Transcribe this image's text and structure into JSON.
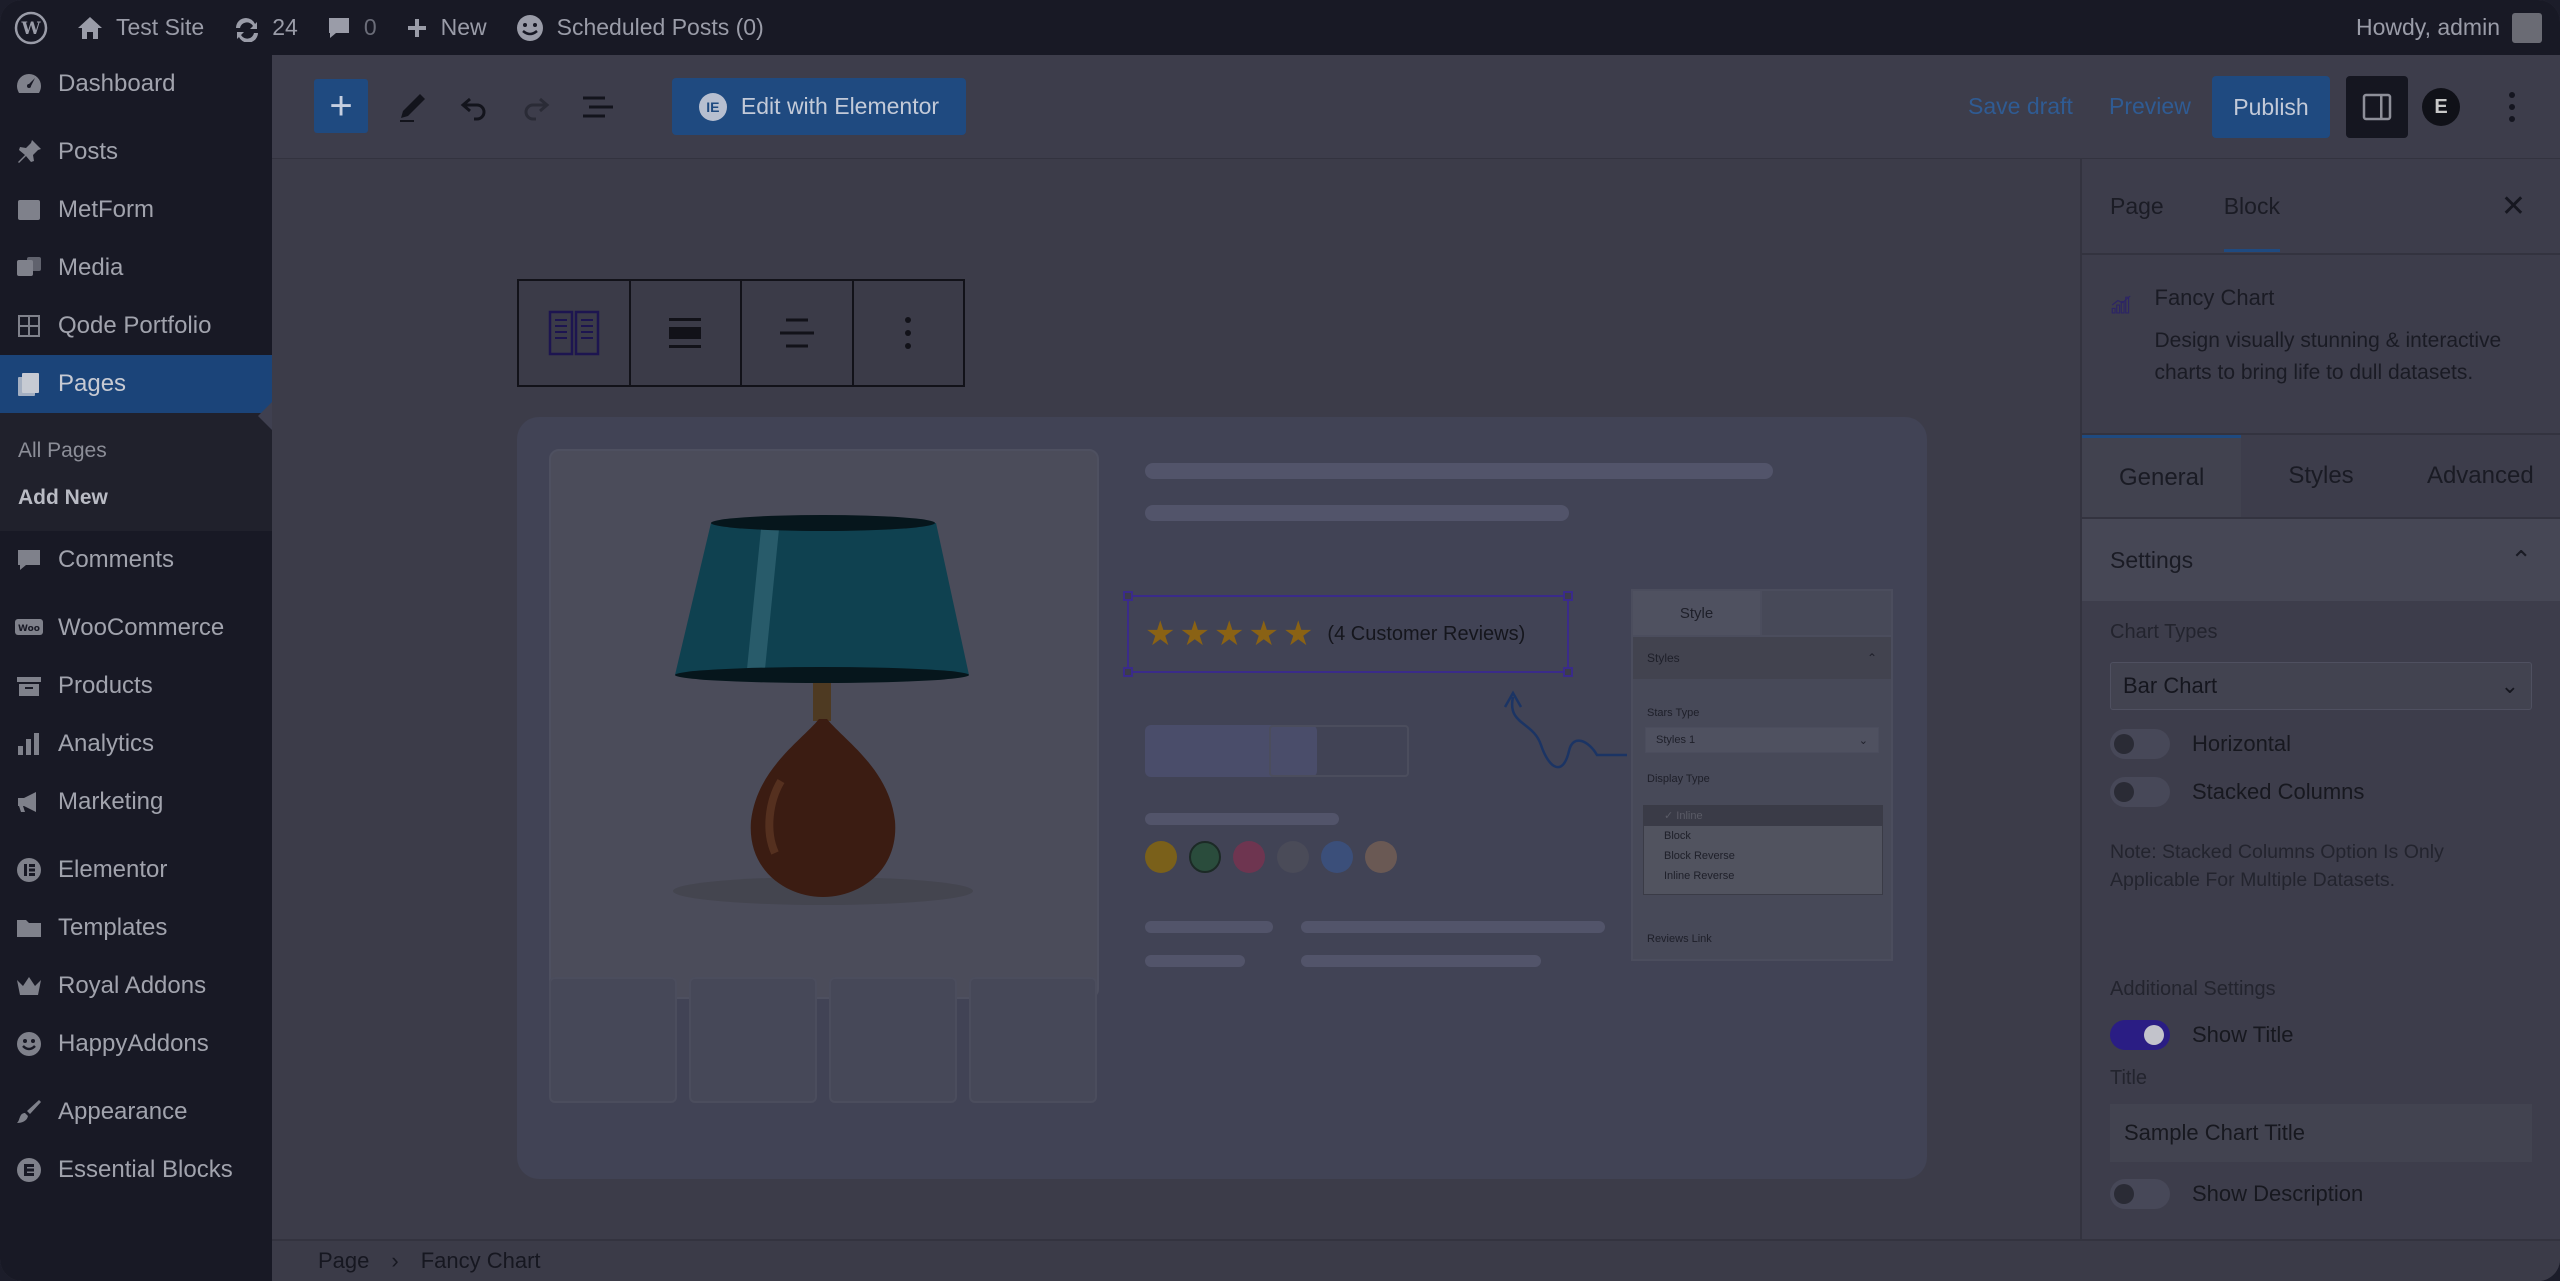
{
  "admin_bar": {
    "site_name": "Test Site",
    "updates_count": "24",
    "comments_count": "0",
    "new_label": "New",
    "scheduled_label": "Scheduled Posts (0)",
    "howdy": "Howdy, admin"
  },
  "sidebar": {
    "items": [
      {
        "label": "Dashboard",
        "icon": "dashboard-icon"
      },
      {
        "label": "Posts",
        "icon": "pin-icon"
      },
      {
        "label": "MetForm",
        "icon": "form-icon"
      },
      {
        "label": "Media",
        "icon": "media-icon"
      },
      {
        "label": "Qode Portfolio",
        "icon": "grid-icon"
      },
      {
        "label": "Pages",
        "icon": "pages-icon"
      },
      {
        "label": "Comments",
        "icon": "comment-icon"
      },
      {
        "label": "WooCommerce",
        "icon": "woo-icon"
      },
      {
        "label": "Products",
        "icon": "archive-icon"
      },
      {
        "label": "Analytics",
        "icon": "bar-chart-icon"
      },
      {
        "label": "Marketing",
        "icon": "megaphone-icon"
      },
      {
        "label": "Elementor",
        "icon": "elementor-icon"
      },
      {
        "label": "Templates",
        "icon": "folder-icon"
      },
      {
        "label": "Royal Addons",
        "icon": "crown-icon"
      },
      {
        "label": "HappyAddons",
        "icon": "smiley-icon"
      },
      {
        "label": "Appearance",
        "icon": "brush-icon"
      },
      {
        "label": "Essential Blocks",
        "icon": "eb-icon"
      }
    ],
    "submenu": {
      "all_pages": "All Pages",
      "add_new": "Add New"
    }
  },
  "toolbar": {
    "edit_with_elementor": "Edit with Elementor",
    "save_draft": "Save draft",
    "preview": "Preview",
    "publish": "Publish"
  },
  "canvas": {
    "review_text": "(4 Customer Reviews)",
    "stars": 5,
    "style_panel": {
      "tab_style": "Style",
      "section": "Styles",
      "stars_type_label": "Stars Type",
      "stars_type_value": "Styles 1",
      "display_type_label": "Display Type",
      "options": [
        "✓ Inline",
        "Block",
        "Block Reverse",
        "Inline Reverse"
      ],
      "reviews_link": "Reviews Link"
    }
  },
  "right_panel": {
    "tab_page": "Page",
    "tab_block": "Block",
    "block_title": "Fancy Chart",
    "block_description": "Design visually stunning & interactive charts to bring life to dull datasets.",
    "subtabs": [
      "General",
      "Styles",
      "Advanced"
    ],
    "section_settings": "Settings",
    "chart_types_label": "Chart Types",
    "chart_type_value": "Bar Chart",
    "horizontal_label": "Horizontal",
    "stacked_label": "Stacked Columns",
    "note": "Note: Stacked Columns Option Is Only Applicable For Multiple Datasets.",
    "additional_settings": "Additional Settings",
    "show_title_label": "Show Title",
    "show_title_on": true,
    "title_label": "Title",
    "title_value": "Sample Chart Title",
    "show_description_label": "Show Description"
  },
  "breadcrumb": {
    "root": "Page",
    "current": "Fancy Chart"
  }
}
